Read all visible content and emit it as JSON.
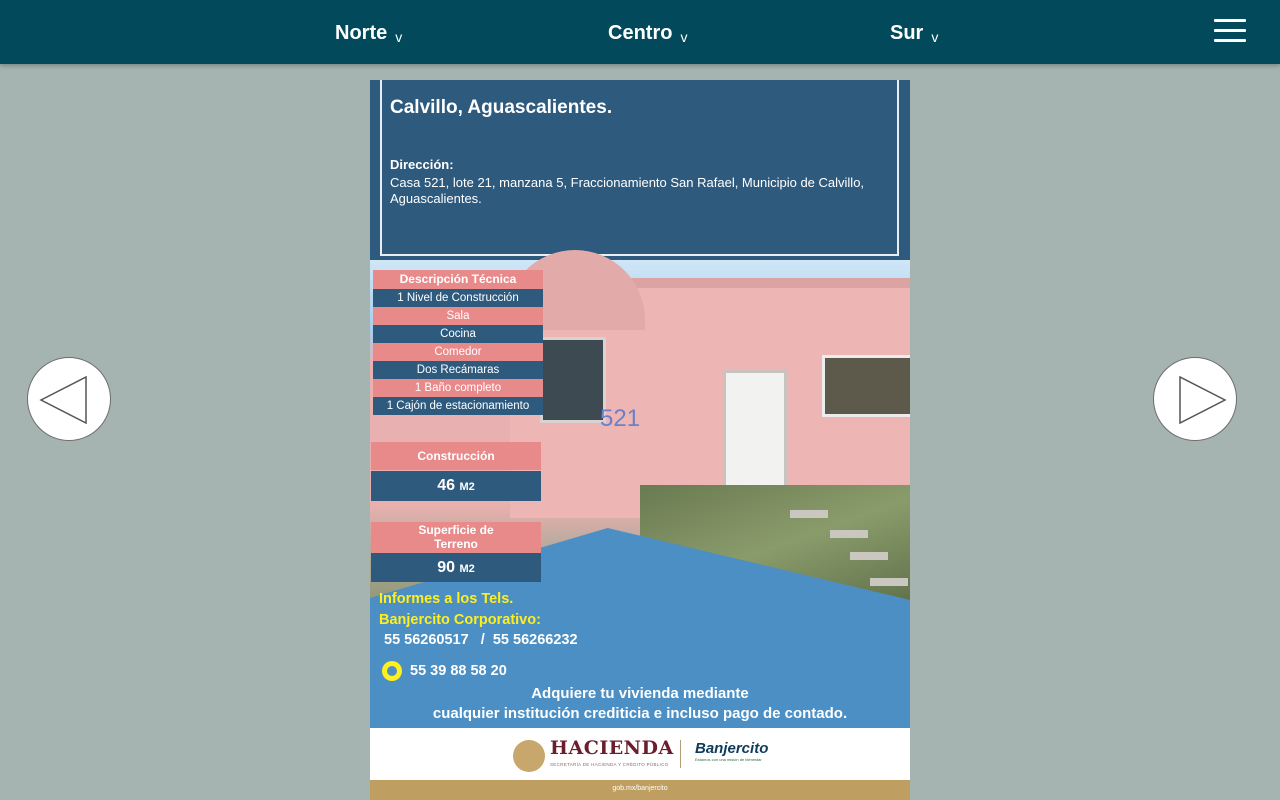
{
  "nav": {
    "items": [
      {
        "label": "Norte",
        "chevron": "v"
      },
      {
        "label": "Centro",
        "chevron": "v"
      },
      {
        "label": "Sur",
        "chevron": "v"
      }
    ]
  },
  "colors": {
    "topbar": "#02495b",
    "page_background": "#a5b4b0",
    "flyer_dark": "#2e5a7e",
    "flyer_blue": "#4b8fc4",
    "flyer_pink": "#e8898a",
    "flyer_yellow": "#ffef1e"
  },
  "icons": {
    "menu": "hamburger-icon",
    "prev": "arrow-left-icon",
    "next": "arrow-right-icon"
  },
  "flyer": {
    "title": "Calvillo, Aguascalientes.",
    "direccion_label": "Dirección:",
    "direccion_text": "Casa  521, lote 21, manzana 5, Fraccionamiento San Rafael, Municipio de Calvillo, Aguascalientes.",
    "house_number": "521",
    "descripcion_title": "Descripción Técnica",
    "descripcion_items": [
      "1 Nivel de Construcción",
      "Sala",
      "Cocina",
      "Comedor",
      "Dos Recámaras",
      "1 Baño completo",
      "1  Cajón de estacionamiento"
    ],
    "construccion_label": "Construcción",
    "construccion_value": "46",
    "construccion_unit": "M2",
    "terreno_label_1": "Superficie de",
    "terreno_label_2": "Terreno",
    "terreno_value": "90",
    "terreno_unit": "M2",
    "informes_1": "Informes a los Tels.",
    "informes_2": "Banjercito Corporativo:",
    "phones": "55 56260517   /  55 56266232",
    "whatsapp": "55 39 88 58 20",
    "cta_1": "Adquiere tu vivienda mediante",
    "cta_2": "cualquier institución crediticia e incluso pago de contado.",
    "hacienda": "HACIENDA",
    "hacienda_sub": "SECRETARÍA DE HACIENDA Y CRÉDITO PÚBLICO",
    "banjercito": "Banjercito",
    "banjercito_sub": "Estamos con una misión de bienestar",
    "social_text": "gob.mx/banjercito"
  }
}
